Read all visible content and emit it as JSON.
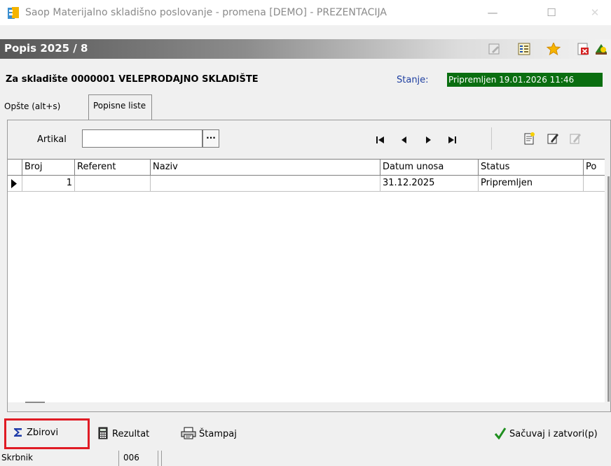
{
  "window": {
    "title": "Saop Materijalno skladišno poslovanje - promena [DEMO] - PREZENTACIJA",
    "minimize_glyph": "—",
    "maximize_glyph": "☐",
    "close_glyph": "✕"
  },
  "header": {
    "title": "Popis 2025 / 8",
    "icons": [
      "edit-icon",
      "list-icon",
      "star-icon",
      "delete-icon",
      "exit-icon"
    ]
  },
  "info": {
    "warehouse": "Za skladište 0000001 VELEPRODAJNO SKLADIŠTE",
    "state_label": "Stanje:",
    "state_value": "Pripremljen 19.01.2026 11:46",
    "state_bg": "#0a6e10"
  },
  "tabs": [
    {
      "label": "Opšte (alt+s)",
      "active": false
    },
    {
      "label": "Popisne liste",
      "active": true
    }
  ],
  "filter": {
    "label": "Artikal",
    "value": "",
    "lookup_button": "···"
  },
  "toolbar": {
    "nav_icons": [
      "first-icon",
      "prev-icon",
      "next-icon",
      "last-icon"
    ],
    "action_icons": [
      "new-doc-icon",
      "edit-doc-icon",
      "edit-disabled-icon"
    ]
  },
  "grid": {
    "columns": [
      "Broj",
      "Referent",
      "Naziv",
      "Datum unosa",
      "Status",
      "Po"
    ],
    "rows": [
      {
        "broj": "1",
        "referent": "",
        "naziv": "",
        "datum": "31.12.2025",
        "status": "Pripremljen",
        "po": ""
      }
    ]
  },
  "bottom": {
    "zbirovi": "Zbirovi",
    "rezultat": "Rezultat",
    "stampaj": "Štampaj",
    "save_close": "Sačuvaj i zatvori(p)",
    "highlight_color": "#e01b24"
  },
  "status_bar": {
    "user": "Skrbnik",
    "code": "006",
    "message": ""
  }
}
